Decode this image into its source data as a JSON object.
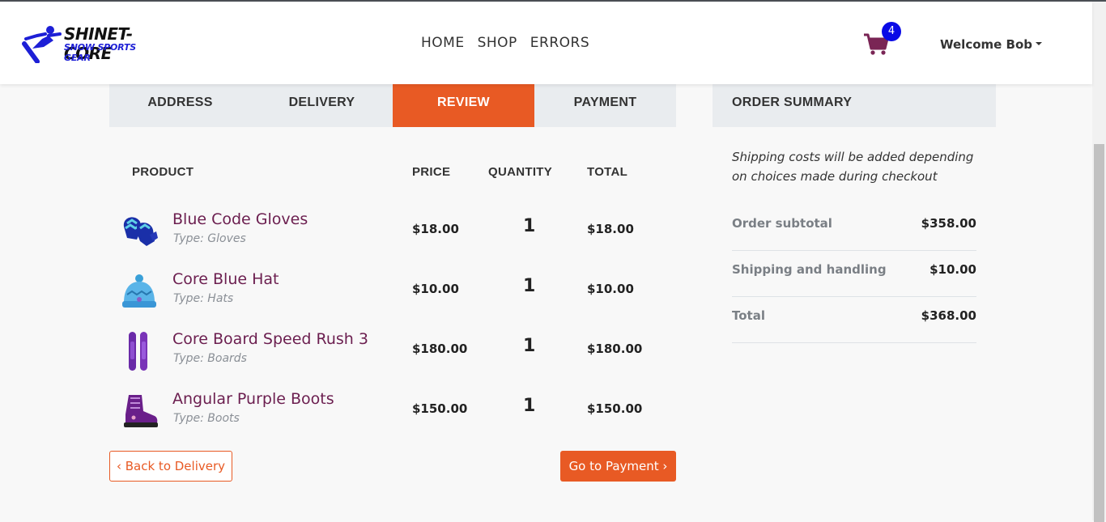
{
  "brand": {
    "name": "SHINET-CORE",
    "tagline": "SNOW SPORTS GEAR"
  },
  "nav": {
    "links": [
      "HOME",
      "SHOP",
      "ERRORS"
    ]
  },
  "cart": {
    "count": "4"
  },
  "user": {
    "welcome": "Welcome Bob"
  },
  "checkout": {
    "steps": [
      "ADDRESS",
      "DELIVERY",
      "REVIEW",
      "PAYMENT"
    ],
    "active_step": "REVIEW",
    "columns": {
      "product": "PRODUCT",
      "price": "PRICE",
      "quantity": "QUANTITY",
      "total": "TOTAL"
    },
    "items": [
      {
        "name": "Blue Code Gloves",
        "type": "Type: Gloves",
        "price": "$18.00",
        "quantity": "1",
        "total": "$18.00",
        "icon": "gloves-icon"
      },
      {
        "name": "Core Blue Hat",
        "type": "Type: Hats",
        "price": "$10.00",
        "quantity": "1",
        "total": "$10.00",
        "icon": "hat-icon"
      },
      {
        "name": "Core Board Speed Rush 3",
        "type": "Type: Boards",
        "price": "$180.00",
        "quantity": "1",
        "total": "$180.00",
        "icon": "snowboard-icon"
      },
      {
        "name": "Angular Purple Boots",
        "type": "Type: Boots",
        "price": "$150.00",
        "quantity": "1",
        "total": "$150.00",
        "icon": "boots-icon"
      }
    ],
    "back_label": "Back to Delivery",
    "next_label": "Go to Payment"
  },
  "summary": {
    "title": "ORDER SUMMARY",
    "note": "Shipping costs will be added depending on choices made during checkout",
    "rows": [
      {
        "label": "Order subtotal",
        "value": "$358.00"
      },
      {
        "label": "Shipping and handling",
        "value": "$10.00"
      },
      {
        "label": "Total",
        "value": "$368.00"
      }
    ]
  },
  "colors": {
    "accent": "#e85a24",
    "product_name": "#6b1e4f",
    "badge": "#0a0ae6",
    "brand_blue": "#1d1fd6"
  }
}
